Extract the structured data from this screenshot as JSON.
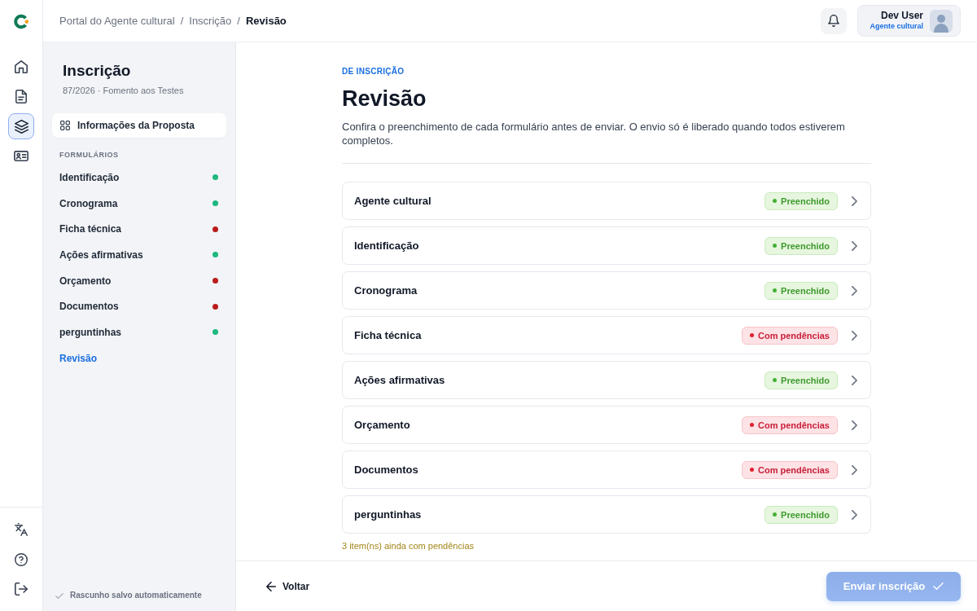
{
  "rail": {
    "items": [
      {
        "kind": "home",
        "selected": false
      },
      {
        "kind": "document",
        "selected": false
      },
      {
        "kind": "layers",
        "selected": true
      },
      {
        "kind": "card",
        "selected": false
      }
    ],
    "bottom_items": [
      {
        "kind": "translate"
      },
      {
        "kind": "help"
      },
      {
        "kind": "logout"
      }
    ]
  },
  "header": {
    "breadcrumbs": [
      {
        "label": "Portal do Agente cultural",
        "current": false
      },
      {
        "label": "Inscrição",
        "current": false
      },
      {
        "label": "Revisão",
        "current": true
      }
    ],
    "separators": [
      "/",
      "/"
    ],
    "user": {
      "name": "Dev User",
      "role": "Agente cultural"
    }
  },
  "sidebar": {
    "title": "Inscrição",
    "subtitle": "87/2026 · Fomento aos Testes",
    "proposal_link": "Informações da Proposta",
    "section_label": "FORMULÁRIOS",
    "items": [
      {
        "label": "Identificação",
        "color": "#1db87e",
        "selected": false
      },
      {
        "label": "Cronograma",
        "color": "#1db87e",
        "selected": false
      },
      {
        "label": "Ficha técnica",
        "color": "#b91c1c",
        "selected": false
      },
      {
        "label": "Ações afirmativas",
        "color": "#1db87e",
        "selected": false
      },
      {
        "label": "Orçamento",
        "color": "#b91c1c",
        "selected": false
      },
      {
        "label": "Documentos",
        "color": "#b91c1c",
        "selected": false
      },
      {
        "label": "perguntinhas",
        "color": "#1db87e",
        "selected": false
      },
      {
        "label": "Revisão",
        "selected": true
      }
    ],
    "autosave": "Rascunho salvo automaticamente"
  },
  "review": {
    "eyebrow": "DE INSCRIÇÃO",
    "title": "Revisão",
    "description": "Confira o preenchimento de cada formulário antes de enviar. O envio só é liberado quando todos estiverem completos.",
    "rows": [
      {
        "name": "Agente cultural",
        "status": {
          "kind": "done",
          "label": "Preenchido"
        }
      },
      {
        "name": "Identificação",
        "status": {
          "kind": "done",
          "label": "Preenchido"
        }
      },
      {
        "name": "Cronograma",
        "status": {
          "kind": "done",
          "label": "Preenchido"
        }
      },
      {
        "name": "Ficha técnica",
        "status": {
          "kind": "pending",
          "label": "Com pendências"
        }
      },
      {
        "name": "Ações afirmativas",
        "status": {
          "kind": "done",
          "label": "Preenchido"
        }
      },
      {
        "name": "Orçamento",
        "status": {
          "kind": "pending",
          "label": "Com pendências"
        }
      },
      {
        "name": "Documentos",
        "status": {
          "kind": "pending",
          "label": "Com pendências"
        }
      },
      {
        "name": "perguntinhas",
        "status": {
          "kind": "done",
          "label": "Preenchido"
        }
      }
    ],
    "pending_note": "3 item(ns) ainda com pendências"
  },
  "footer": {
    "back_button": "Voltar",
    "submit_button": {
      "label": "Enviar inscrição",
      "disabled": true
    }
  }
}
